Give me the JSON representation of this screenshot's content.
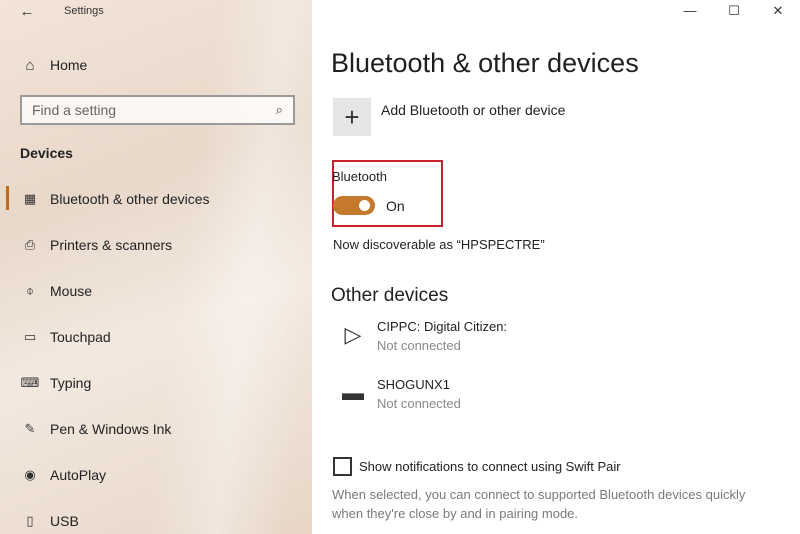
{
  "titlebar": {
    "back_glyph": "←",
    "title": "Settings",
    "minimize_glyph": "—",
    "maximize_glyph": "☐",
    "close_glyph": "✕"
  },
  "sidebar": {
    "home": {
      "icon": "home-icon",
      "glyph": "⌂",
      "label": "Home"
    },
    "search": {
      "placeholder": "Find a setting",
      "icon": "search-icon",
      "glyph": "⌕"
    },
    "section_heading": "Devices",
    "items": [
      {
        "label": "Bluetooth & other devices",
        "icon": "bluetooth-devices-icon",
        "glyph": "▦",
        "selected": true
      },
      {
        "label": "Printers & scanners",
        "icon": "printer-icon",
        "glyph": "⎙",
        "selected": false
      },
      {
        "label": "Mouse",
        "icon": "mouse-icon",
        "glyph": "⌽",
        "selected": false
      },
      {
        "label": "Touchpad",
        "icon": "touchpad-icon",
        "glyph": "▭",
        "selected": false
      },
      {
        "label": "Typing",
        "icon": "keyboard-icon",
        "glyph": "⌨",
        "selected": false
      },
      {
        "label": "Pen & Windows Ink",
        "icon": "pen-icon",
        "glyph": "✎",
        "selected": false
      },
      {
        "label": "AutoPlay",
        "icon": "autoplay-icon",
        "glyph": "◉",
        "selected": false
      },
      {
        "label": "USB",
        "icon": "usb-icon",
        "glyph": "▯",
        "selected": false
      }
    ],
    "accent_color": "#c46a1c"
  },
  "main": {
    "title": "Bluetooth & other devices",
    "add_device": {
      "glyph": "+",
      "label": "Add Bluetooth or other device"
    },
    "bluetooth": {
      "label": "Bluetooth",
      "state_label": "On",
      "enabled": true,
      "toggle_color": "#c47a2a",
      "highlight_color": "#c8222c"
    },
    "discoverable_text": "Now discoverable as “HPSPECTRE”",
    "other_devices": {
      "heading": "Other devices",
      "devices": [
        {
          "name": "CIPPC: Digital Citizen:",
          "status": "Not connected",
          "icon": "media-device-icon",
          "glyph": "▷"
        },
        {
          "name": "SHOGUNX1",
          "status": "Not connected",
          "icon": "drive-device-icon",
          "glyph": "▬"
        }
      ]
    },
    "swift_pair": {
      "label": "Show notifications to connect using Swift Pair",
      "checked": false,
      "description": "When selected, you can connect to supported Bluetooth devices quickly when they're close by and in pairing mode."
    }
  }
}
